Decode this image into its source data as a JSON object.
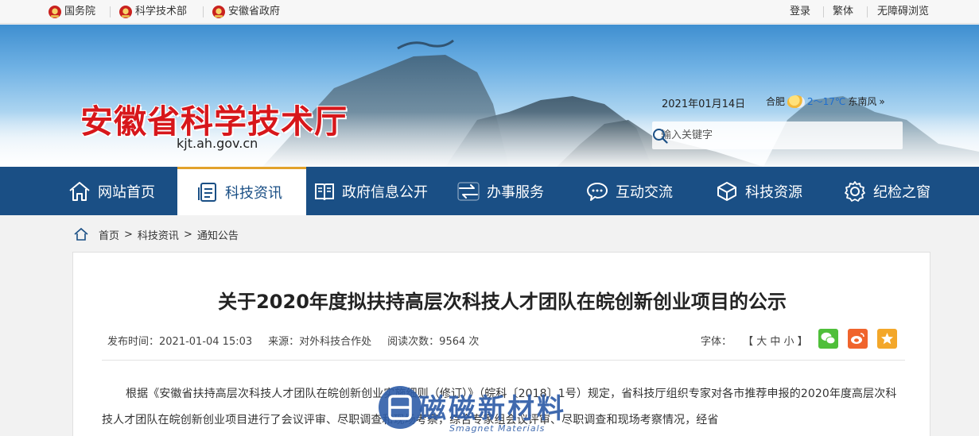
{
  "topbar": {
    "links": [
      "国务院",
      "科学技术部",
      "安徽省政府"
    ],
    "right": [
      "登录",
      "繁体",
      "无障碍浏览"
    ]
  },
  "header": {
    "title": "安徽省科学技术厅",
    "domain": "kjt.ah.gov.cn",
    "date": "2021年01月14日",
    "weather": {
      "city": "合肥",
      "temp": "2～17℃",
      "wind": "东南风",
      "more": "»",
      "icon": "sun-cloud-icon"
    },
    "search": {
      "placeholder": "输入关键字",
      "icon": "search-icon"
    }
  },
  "nav": {
    "items": [
      {
        "label": "网站首页",
        "icon": "home-icon"
      },
      {
        "label": "科技资讯",
        "icon": "document-icon",
        "active": true
      },
      {
        "label": "政府信息公开",
        "icon": "book-icon"
      },
      {
        "label": "办事服务",
        "icon": "service-icon"
      },
      {
        "label": "互动交流",
        "icon": "chat-icon"
      },
      {
        "label": "科技资源",
        "icon": "cube-icon"
      },
      {
        "label": "纪检之窗",
        "icon": "gear-icon"
      }
    ]
  },
  "breadcrumb": {
    "home": "首页",
    "sep": ">",
    "level1": "科技资讯",
    "level2": "通知公告"
  },
  "article": {
    "title": "关于2020年度拟扶持高层次科技人才团队在皖创新创业项目的公示",
    "meta": {
      "date": "发布时间：2021-01-04 15:03",
      "source": "来源：对外科技合作处",
      "views": "阅读次数：9564 次"
    },
    "font_size": {
      "label": "字体：",
      "options": "【 大 中 小 】"
    },
    "share": [
      {
        "name": "wechat-icon",
        "color": "#4fbf3a"
      },
      {
        "name": "weibo-icon",
        "color": "#f0642c"
      },
      {
        "name": "favorite-icon",
        "color": "#f3a72a"
      }
    ],
    "body": "根据《安徽省扶持高层次科技人才团队在皖创新创业实施细则（修订）》（皖科〔2018〕1号）规定，省科技厅组织专家对各市推荐申报的2020年度高层次科技人才团队在皖创新创业项目进行了会议评审、尽职调查和现场考察，综合专家组会议评审、尽职调查和现场考察情况，经省"
  },
  "watermark": {
    "name": "磁磁新材料",
    "sub": "Smagnet Materials"
  }
}
